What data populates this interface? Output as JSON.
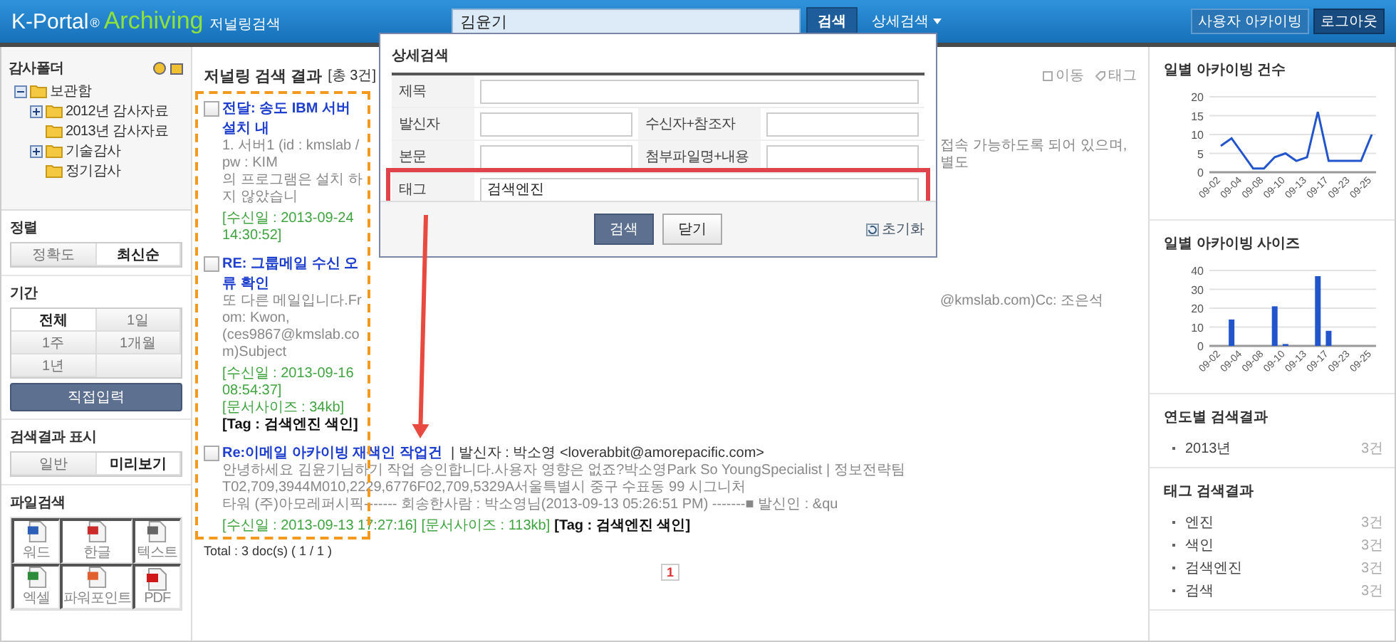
{
  "header": {
    "logo": "K-Portal",
    "logo_mark": "®",
    "logo_accent": "Archiving",
    "subtitle": "저널링검색",
    "search_value": "김윤기",
    "search_button": "검색",
    "advanced_link": "상세검색",
    "buttons": [
      {
        "label": "사용자 아카이빙",
        "selected": false
      },
      {
        "label": "로그아웃",
        "selected": true
      }
    ]
  },
  "sidebar": {
    "folder_title": "감사폴더",
    "tree": [
      {
        "label": "보관함",
        "expanded": true,
        "children": [
          {
            "label": "2012년 감사자료",
            "expanded": false
          },
          {
            "label": "2013년 감사자료"
          },
          {
            "label": "기술감사",
            "expanded": false
          },
          {
            "label": "정기감사"
          }
        ]
      }
    ],
    "sort": {
      "title": "정렬",
      "options": [
        {
          "label": "정확도",
          "selected": false
        },
        {
          "label": "최신순",
          "selected": true
        }
      ]
    },
    "period": {
      "title": "기간",
      "options": [
        {
          "label": "전체",
          "selected": true
        },
        {
          "label": "1일",
          "selected": false
        },
        {
          "label": "1주",
          "selected": false
        },
        {
          "label": "1개월",
          "selected": false
        },
        {
          "label": "1년",
          "selected": false
        }
      ],
      "button": "직접입력"
    },
    "display": {
      "title": "검색결과 표시",
      "options": [
        {
          "label": "일반",
          "selected": false
        },
        {
          "label": "미리보기",
          "selected": true
        }
      ]
    },
    "file_search": {
      "title": "파일검색",
      "types": [
        {
          "label": "워드",
          "kind": "word"
        },
        {
          "label": "한글",
          "kind": "hwp"
        },
        {
          "label": "텍스트",
          "kind": "text"
        },
        {
          "label": "엑셀",
          "kind": "excel"
        },
        {
          "label": "파워포인트",
          "kind": "ppt"
        },
        {
          "label": "PDF",
          "kind": "pdf"
        }
      ]
    }
  },
  "results": {
    "title": "저널링 검색 결과",
    "count": "[총 3건]",
    "actions": [
      {
        "label": "이동",
        "kind": "move"
      },
      {
        "label": "태그",
        "kind": "tag"
      }
    ],
    "items": [
      {
        "checked": false,
        "title": "전달: 송도 IBM 서버 설치 내",
        "lines": [
          {
            "left": "1. 서버1 (id : kmslab / pw : KIM",
            "right": "접속 가능하도록 되어 있으며, 별도"
          },
          {
            "left": "의 프로그램은 설치 하지 않았습니"
          }
        ],
        "date": "[수신일 : 2013-09-24 14:30:52]"
      },
      {
        "checked": false,
        "title": "RE: 그룹메일 수신 오류 확인",
        "lines": [
          {
            "left": "또 다른 메일입니다.From: Kwon,",
            "right": "@kmslab.com)Cc: 조은석"
          },
          {
            "left": "(ces9867@kmslab.com)Subject"
          }
        ],
        "date": "[수신일 : 2013-09-16 08:54:37]",
        "size": "[문서사이즈 : 34kb]",
        "tag": "[Tag : 검색엔진 색인]"
      },
      {
        "checked": false,
        "title": "Re:이메일 아카이빙 재색인 작업건",
        "sender": "| 발신자 : 박소영 <loverabbit@amorepacific.com>",
        "lines": [
          {
            "left": "안녕하세요 김윤기님하기 작업 승인합니다.사용자 영향은 없죠?박소영Park So YoungSpecialist | 정보전략팀T02,709,3944M010,2229,6776F02,709,5329A서울특별시 중구 수표동 99 시그니처"
          },
          {
            "left": "타워 (주)아모레퍼시픽------- 회송한사람 : 박소영님(2013-09-13 05:26:51 PM) -------■ 발신인 : &qu"
          }
        ],
        "date": "[수신일 : 2013-09-13 17:27:16]",
        "size": "[문서사이즈 : 113kb]",
        "tag": "[Tag : 검색엔진 색인]"
      }
    ],
    "total": "Total : 3 doc(s) ( 1 / 1 )",
    "pages": [
      {
        "label": "1",
        "selected": true
      }
    ]
  },
  "advanced_search": {
    "title": "상세검색",
    "rows": [
      {
        "highlighted": false,
        "fields": [
          {
            "label": "제목"
          }
        ]
      },
      {
        "highlighted": false,
        "fields": [
          {
            "label": "발신자"
          },
          {
            "label": "수신자+참조자"
          }
        ]
      },
      {
        "highlighted": false,
        "fields": [
          {
            "label": "본문"
          },
          {
            "label": "첨부파일명+내용"
          }
        ]
      },
      {
        "highlighted": true,
        "fields": [
          {
            "label": "태그",
            "value": "검색엔진"
          }
        ]
      }
    ],
    "buttons": [
      {
        "label": "검색",
        "kind": "primary"
      },
      {
        "label": "닫기",
        "kind": "secondary"
      }
    ],
    "reset": "초기화"
  },
  "right": {
    "charts": [
      {
        "title": "일별 아카이빙 건수",
        "chart_data": {
          "type": "line",
          "categories": [
            "09-02",
            null,
            "09-04",
            null,
            "09-08",
            null,
            "09-10",
            null,
            "09-13",
            null,
            "09-17",
            null,
            "09-23",
            null,
            "09-25"
          ],
          "ylim": [
            0,
            20
          ],
          "yticks": [
            0,
            5,
            10,
            15,
            20
          ],
          "grid": true,
          "series": [
            {
              "color": "#2255cc",
              "values": [
                7,
                9,
                5,
                1,
                1,
                4,
                5,
                3,
                4,
                16,
                3,
                3,
                3,
                3,
                10
              ]
            }
          ]
        }
      },
      {
        "title": "일별 아카이빙 사이즈",
        "chart_data": {
          "type": "bar",
          "categories": [
            "09-02",
            null,
            "09-04",
            null,
            "09-08",
            null,
            "09-10",
            null,
            "09-13",
            null,
            "09-17",
            null,
            "09-23",
            null,
            "09-25"
          ],
          "ylim": [
            0,
            40
          ],
          "yticks": [
            0,
            10,
            20,
            30,
            40
          ],
          "grid": true,
          "series": [
            {
              "color": "#2255cc",
              "values": [
                0,
                14,
                0,
                0,
                0,
                21,
                1,
                0,
                0,
                37,
                8,
                0,
                0,
                0,
                0
              ]
            }
          ]
        }
      }
    ],
    "year_results": {
      "title": "연도별 검색결과",
      "items": [
        {
          "label": "2013년",
          "count": "3건"
        }
      ]
    },
    "tag_results": {
      "title": "태그 검색결과",
      "items": [
        {
          "label": "엔진",
          "count": "3건"
        },
        {
          "label": "색인",
          "count": "3건"
        },
        {
          "label": "검색엔진",
          "count": "3건"
        },
        {
          "label": "검색",
          "count": "3건"
        }
      ]
    }
  }
}
